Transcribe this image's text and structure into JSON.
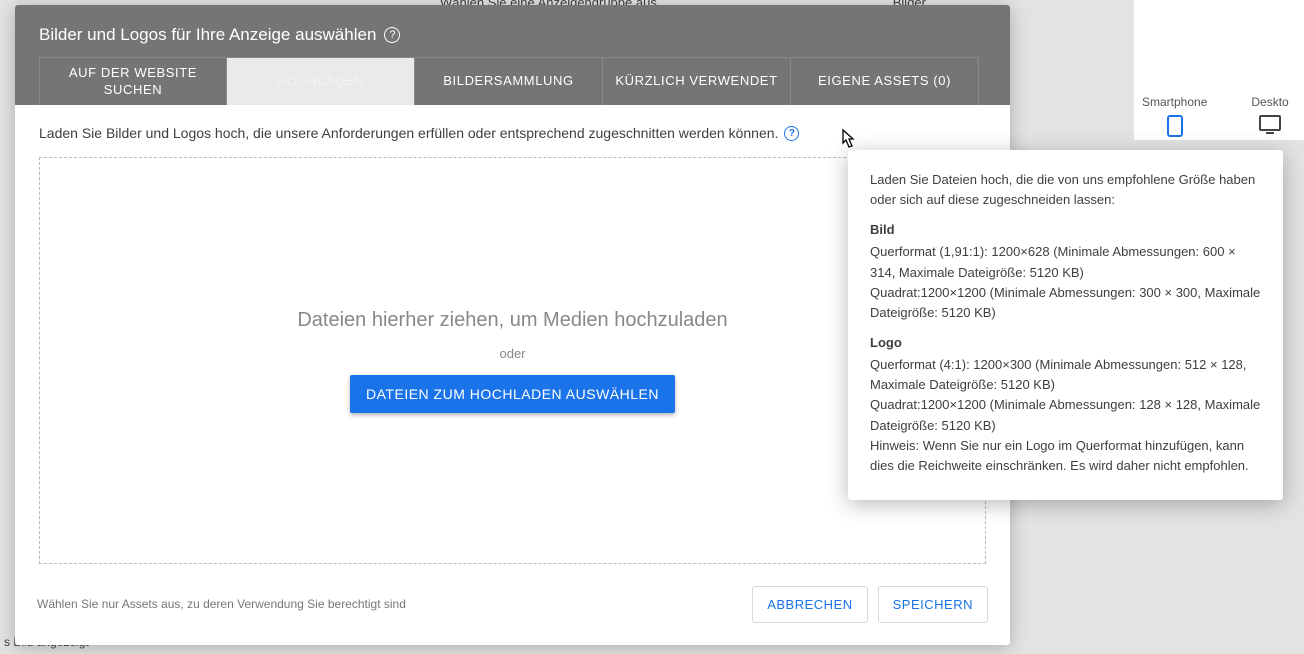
{
  "background": {
    "adgroup_hint": "Wählen Sie eine Anzeigengruppe aus",
    "bilder_label": "Bilder",
    "devices": {
      "smartphone": "Smartphone",
      "desktop": "Deskto"
    },
    "bottom_fragment": "s Bild angezeigt"
  },
  "modal": {
    "title": "Bilder und Logos für Ihre Anzeige auswählen",
    "tabs": {
      "website": "AUF DER WEBSITE SUCHEN",
      "upload": "HOCHLADEN",
      "collection": "BILDERSAMMLUNG",
      "recent": "KÜRZLICH VERWENDET",
      "assets": "EIGENE ASSETS (0)"
    },
    "instruction": "Laden Sie Bilder und Logos hoch, die unsere Anforderungen erfüllen oder entsprechend zugeschnitten werden können.",
    "dropzone": {
      "headline": "Dateien hierher ziehen, um Medien hochzuladen",
      "separator": "oder",
      "button": "DATEIEN ZUM HOCHLADEN AUSWÄHLEN"
    },
    "footer": {
      "note": "Wählen Sie nur Assets aus, zu deren Verwendung Sie berechtigt sind",
      "cancel": "ABBRECHEN",
      "save": "SPEICHERN"
    }
  },
  "tooltip": {
    "intro": "Laden Sie Dateien hoch, die die von uns empfohlene Größe haben oder sich auf diese zugeschneiden lassen:",
    "bild_title": "Bild",
    "bild_line1": "Querformat (1,91:1): 1200×628 (Minimale Abmessungen: 600 × 314, Maximale Dateigröße: 5120 KB)",
    "bild_line2": "Quadrat:1200×1200 (Minimale Abmessungen: 300 × 300, Maximale Dateigröße: 5120 KB)",
    "logo_title": "Logo",
    "logo_line1": "Querformat (4:1): 1200×300 (Minimale Abmessungen: 512 × 128, Maximale Dateigröße: 5120 KB)",
    "logo_line2": "Quadrat:1200×1200 (Minimale Abmessungen: 128 × 128, Maximale Dateigröße: 5120 KB)",
    "logo_note": "Hinweis: Wenn Sie nur ein Logo im Querformat hinzufügen, kann dies die Reichweite einschränken. Es wird daher nicht empfohlen."
  }
}
